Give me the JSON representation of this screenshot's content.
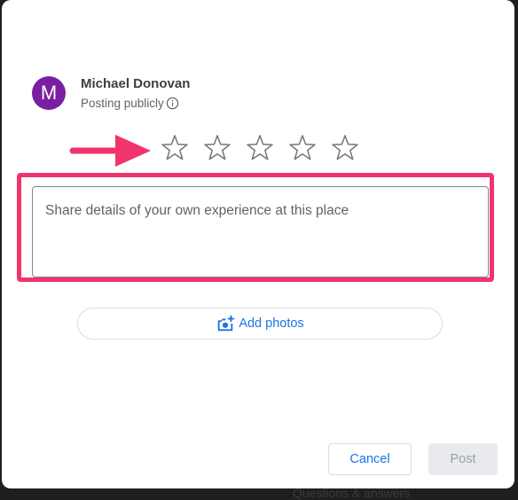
{
  "user": {
    "avatar_letter": "M",
    "name": "Michael Donovan",
    "visibility": "Posting publicly"
  },
  "rating": {
    "max_stars": 5,
    "selected": 0
  },
  "review": {
    "placeholder": "Share details of your own experience at this place"
  },
  "actions": {
    "add_photos_label": "Add photos",
    "cancel_label": "Cancel",
    "post_label": "Post"
  },
  "background": {
    "partial_text": "Questions & answers"
  },
  "colors": {
    "avatar": "#7b1fa2",
    "accent": "#1a73e8",
    "annotation": "#f0356d"
  },
  "icons": [
    "info-icon",
    "star-outline-icon",
    "add-photo-icon",
    "arrow-annotation"
  ]
}
